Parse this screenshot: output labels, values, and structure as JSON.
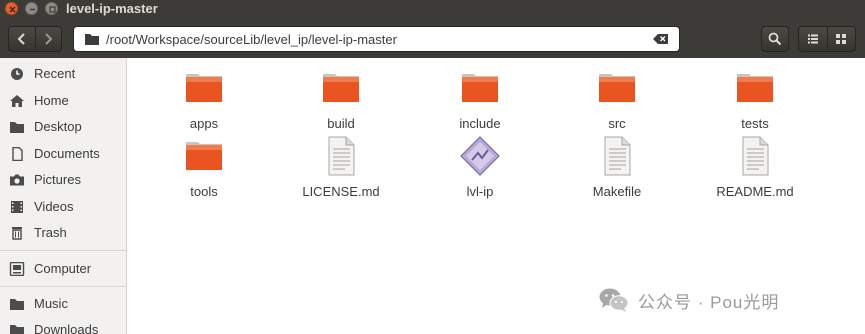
{
  "window": {
    "title": "level-ip-master"
  },
  "toolbar": {
    "path": "/root/Workspace/sourceLib/level_ip/level-ip-master",
    "icons": [
      "back-icon",
      "forward-icon",
      "folder-icon",
      "clear-icon",
      "search-icon",
      "list-view-icon",
      "grid-menu-icon"
    ]
  },
  "sidebar": {
    "items": [
      {
        "label": "Recent",
        "icon": "clock-icon"
      },
      {
        "label": "Home",
        "icon": "home-icon"
      },
      {
        "label": "Desktop",
        "icon": "desktop-folder-icon"
      },
      {
        "label": "Documents",
        "icon": "document-icon"
      },
      {
        "label": "Pictures",
        "icon": "camera-icon"
      },
      {
        "label": "Videos",
        "icon": "film-icon"
      },
      {
        "label": "Trash",
        "icon": "trash-icon"
      },
      {
        "label": "Computer",
        "icon": "computer-icon"
      },
      {
        "label": "Music",
        "icon": "music-folder-icon"
      },
      {
        "label": "Downloads",
        "icon": "download-folder-icon"
      }
    ]
  },
  "files": [
    {
      "name": "apps",
      "type": "folder"
    },
    {
      "name": "build",
      "type": "folder"
    },
    {
      "name": "include",
      "type": "folder"
    },
    {
      "name": "src",
      "type": "folder"
    },
    {
      "name": "tests",
      "type": "folder"
    },
    {
      "name": "tools",
      "type": "folder"
    },
    {
      "name": "LICENSE.md",
      "type": "text"
    },
    {
      "name": "lvl-ip",
      "type": "executable"
    },
    {
      "name": "Makefile",
      "type": "text"
    },
    {
      "name": "README.md",
      "type": "text"
    }
  ],
  "watermark": {
    "text": "公众号 · Pou光明"
  },
  "colors": {
    "titlebar": "#3c3b37",
    "folder_orange": "#e95420",
    "close_button": "#e2622f",
    "sidebar_bg": "#f2f1f0"
  }
}
